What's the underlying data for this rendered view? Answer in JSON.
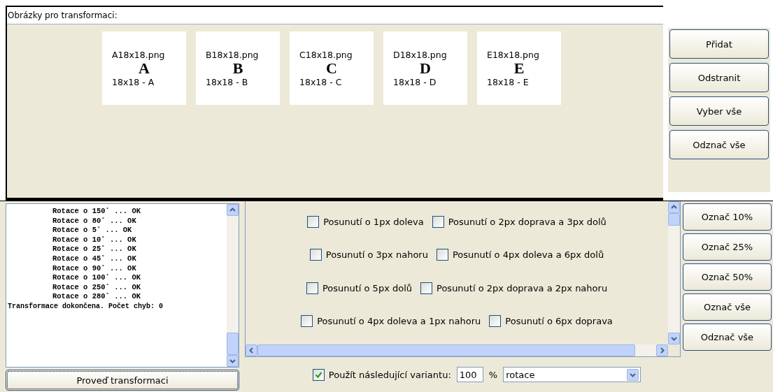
{
  "images_panel": {
    "title": "Obrázky pro transformaci:",
    "images": [
      {
        "filename": "A18x18.png",
        "letter": "A",
        "caption": "18x18 - A"
      },
      {
        "filename": "B18x18.png",
        "letter": "B",
        "caption": "18x18 - B"
      },
      {
        "filename": "C18x18.png",
        "letter": "C",
        "caption": "18x18 - C"
      },
      {
        "filename": "D18x18.png",
        "letter": "D",
        "caption": "18x18 - D"
      },
      {
        "filename": "E18x18.png",
        "letter": "E",
        "caption": "18x18 - E"
      }
    ],
    "buttons": [
      "Přidat",
      "Odstranit",
      "Vyber vše",
      "Odznač vše"
    ]
  },
  "log": {
    "lines": [
      "Rotace o 150˚ ... OK",
      "Rotace o 80˚ ... OK",
      "Rotace o 5˚ ... OK",
      "Rotace o 10˚ ... OK",
      "Rotace o 25˚ ... OK",
      "Rotace o 45˚ ... OK",
      "Rotace o 90˚ ... OK",
      "Rotace o 100˚ ... OK",
      "Rotace o 250˚ ... OK",
      "Rotace o 280˚ ... OK"
    ],
    "summary": "Transformace dokončena. Počet chyb: 0"
  },
  "run_button": "Proveď transformaci",
  "options": [
    {
      "label": "Posunutí o 1px doleva",
      "checked": false
    },
    {
      "label": "Posunutí o 2px doprava a 3px dolů",
      "checked": false
    },
    {
      "label": "Posunutí o 3px nahoru",
      "checked": false
    },
    {
      "label": "Posunutí o 4px doleva a 6px dolů",
      "checked": false
    },
    {
      "label": "Posunutí o 5px dolů",
      "checked": false
    },
    {
      "label": "Posunutí o 2px doprava a 2px nahoru",
      "checked": false
    },
    {
      "label": "Posunutí o 4px doleva a 1px nahoru",
      "checked": false
    },
    {
      "label": "Posunutí o 6px doprava",
      "checked": false
    }
  ],
  "mark_buttons": [
    "Označ 10%",
    "Označ 25%",
    "Označ 50%",
    "Označ vše",
    "Odznač vše"
  ],
  "variant": {
    "label": "Použít následující variantu:",
    "checked": true,
    "percent": "100",
    "unit": "%",
    "value": "rotace"
  }
}
